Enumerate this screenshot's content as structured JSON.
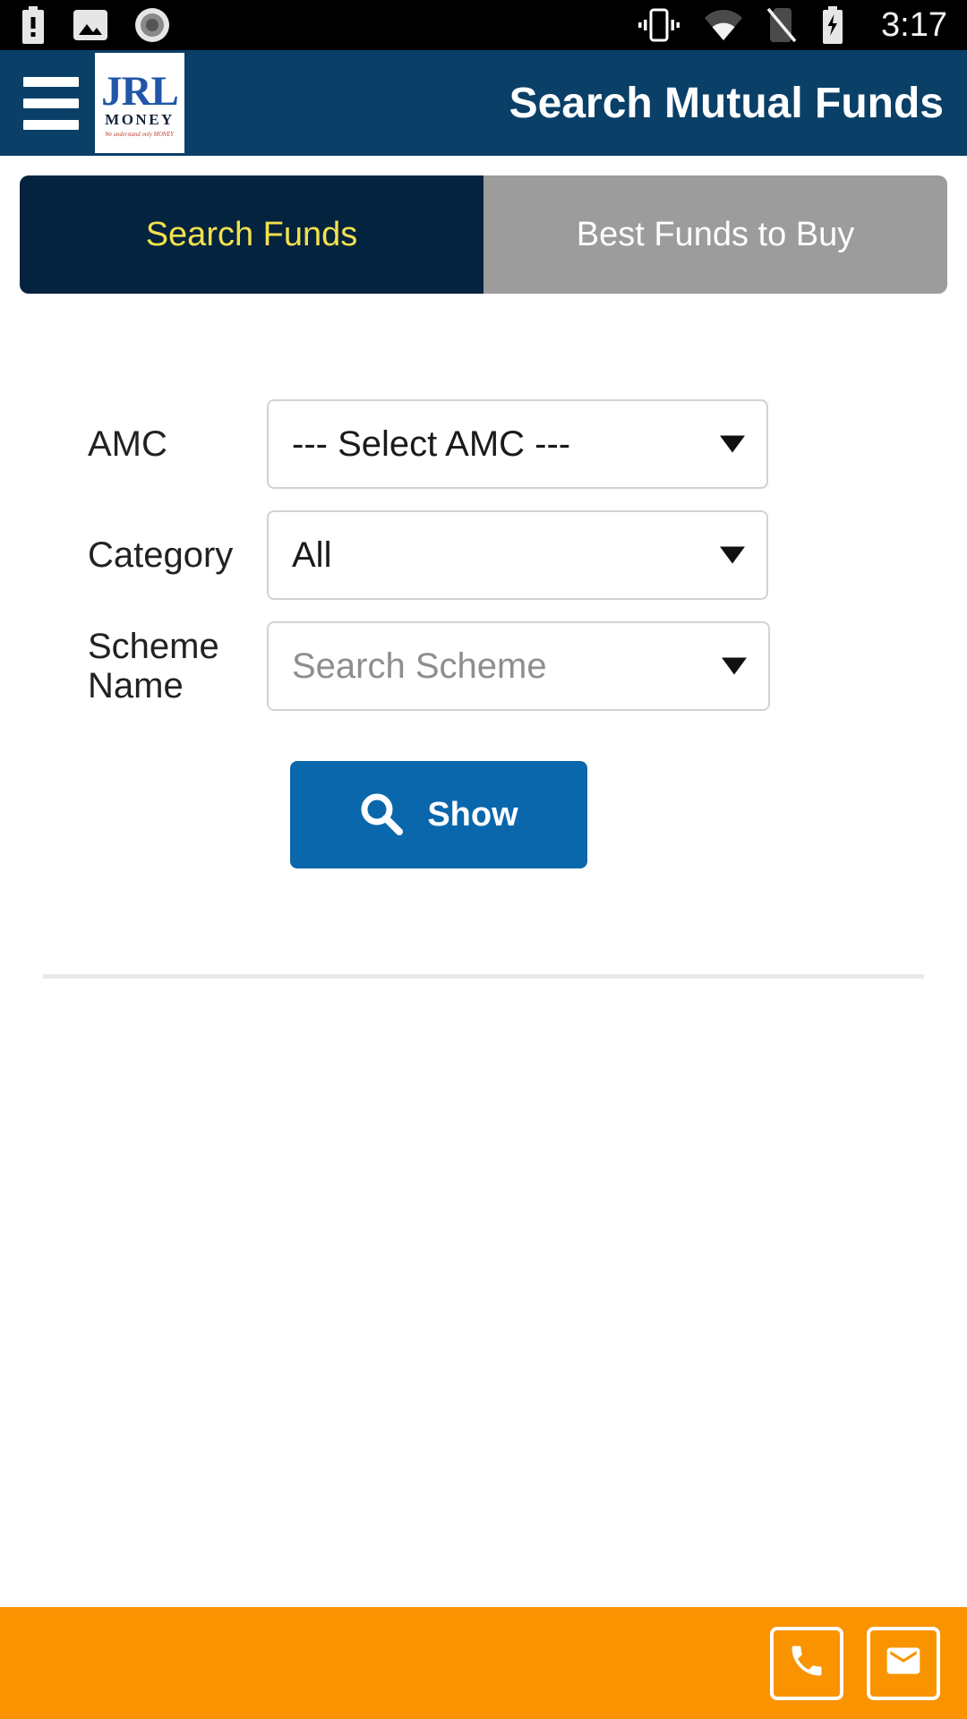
{
  "status_bar": {
    "time": "3:17",
    "left_icons": [
      "battery-alert-icon",
      "gallery-icon",
      "record-icon"
    ],
    "right_icons": [
      "vibrate-icon",
      "wifi-icon",
      "no-sim-icon",
      "battery-charging-icon"
    ]
  },
  "header": {
    "title": "Search Mutual Funds",
    "menu_icon": "hamburger-icon",
    "logo": {
      "primary": "JRL",
      "secondary": "MONEY",
      "tagline": "We understand only MONEY"
    },
    "background_color": "#0a4068"
  },
  "tabs": [
    {
      "label": "Search Funds",
      "active": true,
      "bg": "#04233f",
      "fg": "#f2e14c"
    },
    {
      "label": "Best Funds to Buy",
      "active": false,
      "bg": "#9c9c9c",
      "fg": "#ffffff"
    }
  ],
  "form": {
    "fields": [
      {
        "label": "AMC",
        "value": "--- Select AMC ---",
        "is_placeholder": false
      },
      {
        "label": "Category",
        "value": "All",
        "is_placeholder": false
      },
      {
        "label": "Scheme Name",
        "value": "Search Scheme",
        "is_placeholder": true
      }
    ],
    "submit": {
      "label": "Show",
      "icon": "search-icon",
      "color": "#0a67ac"
    }
  },
  "footer": {
    "background_color": "#f99300",
    "actions": [
      {
        "name": "call",
        "icon": "phone-icon"
      },
      {
        "name": "email",
        "icon": "envelope-icon"
      }
    ]
  }
}
